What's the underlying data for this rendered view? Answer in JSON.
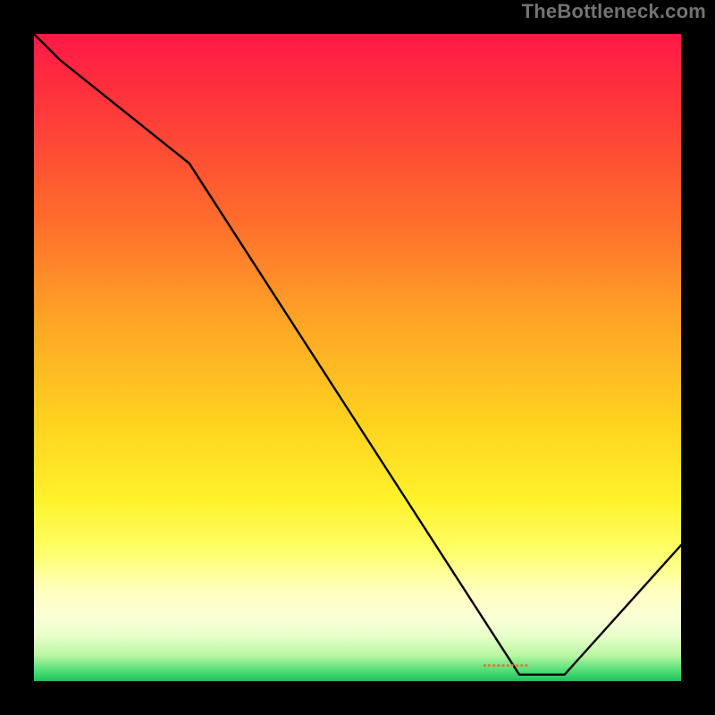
{
  "watermark": "TheBottleneck.com",
  "colors": {
    "line": "#000000",
    "marker_text": "#ff6a33"
  },
  "chart_data": {
    "type": "line",
    "title": "",
    "xlabel": "",
    "ylabel": "",
    "xlim": [
      0,
      100
    ],
    "ylim": [
      0,
      100
    ],
    "x": [
      0,
      4,
      24,
      75,
      82,
      100
    ],
    "values": [
      100,
      96,
      80,
      1,
      1,
      21
    ],
    "annotations": [
      {
        "text_ref": "marker.text",
        "x": 77,
        "y": 2
      }
    ]
  },
  "marker": {
    "text": "••••••••••"
  }
}
